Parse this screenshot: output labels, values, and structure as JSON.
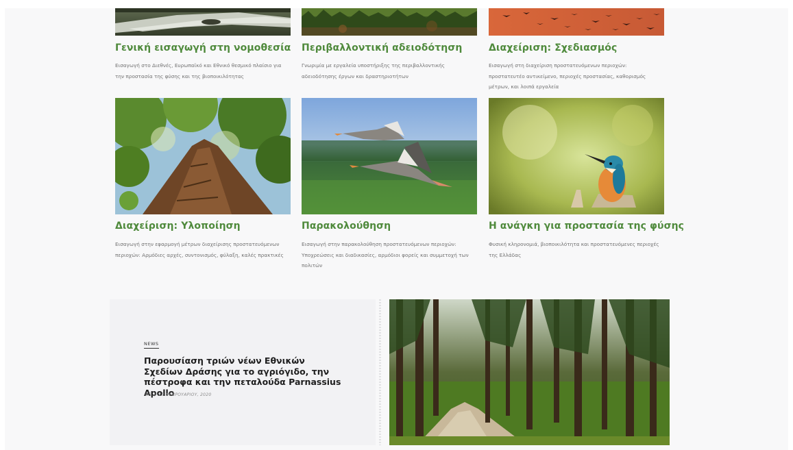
{
  "cards": [
    {
      "title": "Γενική εισαγωγή στη νομοθεσία",
      "description": "Εισαγωγή στο Διεθνές, Ευρωπαϊκό και Εθνικό θεσμικό πλαίσιο για την προστασία της φύσης και της βιοποικιλότητας"
    },
    {
      "title": "Περιβαλλοντική αδειοδότηση",
      "description": "Γνωριμία με εργαλεία υποστήριξης της περιβαλλοντικής αδειοδότησης έργων και δραστηριοτήτων"
    },
    {
      "title": "Διαχείριση: Σχεδιασμός",
      "description": "Εισαγωγή στη διαχείριση προστατευόμενων περιοχών: προστατευτέο αντικείμενο, περιοχές προστασίας, καθορισμός μέτρων, και λοιπά εργαλεία"
    },
    {
      "title": "Διαχείριση: Υλοποίηση",
      "description": "Εισαγωγή στην εφαρμογή μέτρων διαχείρισης προστατευόμενων περιοχών: Αρμόδιες αρχές, συντονισμός, φύλαξη, καλές πρακτικές"
    },
    {
      "title": "Παρακολούθηση",
      "description": "Εισαγωγή στην παρακολούθηση προστατευόμενων περιοχών: Υποχρεώσεις και διαδικασίες, αρμόδιοι φορείς και συμμετοχή των πολιτών"
    },
    {
      "title": "Η ανάγκη για προστασία της φύσης",
      "description": "Φυσική κληρονομιά, βιοποικιλότητα και προστατευόμενες περιοχές της Ελλάδας"
    }
  ],
  "news": {
    "badge": "NEWS",
    "title": "Παρουσίαση τριών νέων Εθνικών Σχεδίων Δράσης για το αγριόγιδο, την πέστροφα και την πεταλούδα Parnassius Apollo",
    "author": "DS",
    "separator": "/",
    "date": "13 ΦΕΒΡΟΥΑΡΙΟΥ, 2020"
  },
  "colors": {
    "accent": "#4f8a3c",
    "text": "#1e1e1e",
    "muted": "#717171"
  }
}
